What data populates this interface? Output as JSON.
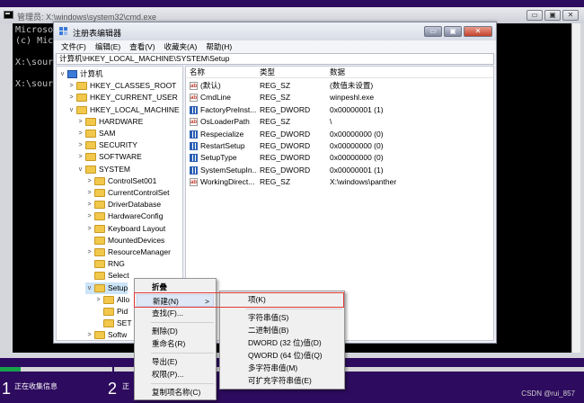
{
  "cmd": {
    "title": "管理员: X:\\windows\\system32\\cmd.exe",
    "lines": [
      "Microsof",
      "(c) Micr",
      "",
      "X:\\sourc",
      "",
      "X:\\sourc"
    ],
    "buttons": [
      "▭",
      "▣",
      "✕"
    ]
  },
  "setup": {
    "progress_fraction": 0.035,
    "step1_number": "1",
    "step1_label": "正在收集信息",
    "step2_number": "2",
    "step2_label": "正",
    "watermark": "CSDN @rui_857"
  },
  "regedit": {
    "title": "注册表编辑器",
    "buttons": [
      "▭",
      "▣",
      "✕"
    ],
    "menus": [
      "文件(F)",
      "编辑(E)",
      "查看(V)",
      "收藏夹(A)",
      "帮助(H)"
    ],
    "address": "计算机\\HKEY_LOCAL_MACHINE\\SYSTEM\\Setup",
    "tree": [
      {
        "label": "计算机",
        "expander": "v",
        "icon": "computer"
      },
      {
        "label": "HKEY_CLASSES_ROOT",
        "expander": ">",
        "icon": "folder"
      },
      {
        "label": "HKEY_CURRENT_USER",
        "expander": ">",
        "icon": "folder"
      },
      {
        "label": "HKEY_LOCAL_MACHINE",
        "expander": "v",
        "icon": "folder"
      },
      {
        "label": "HARDWARE",
        "expander": ">",
        "icon": "folder"
      },
      {
        "label": "SAM",
        "expander": ">",
        "icon": "folder"
      },
      {
        "label": "SECURITY",
        "expander": ">",
        "icon": "folder"
      },
      {
        "label": "SOFTWARE",
        "expander": ">",
        "icon": "folder"
      },
      {
        "label": "SYSTEM",
        "expander": "v",
        "icon": "folder"
      },
      {
        "label": "ControlSet001",
        "expander": ">",
        "icon": "folder"
      },
      {
        "label": "CurrentControlSet",
        "expander": ">",
        "icon": "folder"
      },
      {
        "label": "DriverDatabase",
        "expander": ">",
        "icon": "folder"
      },
      {
        "label": "HardwareConfig",
        "expander": ">",
        "icon": "folder"
      },
      {
        "label": "Keyboard Layout",
        "expander": ">",
        "icon": "folder"
      },
      {
        "label": "MountedDevices",
        "expander": "",
        "icon": "folder"
      },
      {
        "label": "ResourceManager",
        "expander": ">",
        "icon": "folder"
      },
      {
        "label": "RNG",
        "expander": "",
        "icon": "folder"
      },
      {
        "label": "Select",
        "expander": "",
        "icon": "folder"
      },
      {
        "label": "Setup",
        "expander": "v",
        "icon": "folder"
      },
      {
        "label": "Allo",
        "expander": ">",
        "icon": "folder"
      },
      {
        "label": "Pid",
        "expander": "",
        "icon": "folder"
      },
      {
        "label": "SET",
        "expander": "",
        "icon": "folder"
      },
      {
        "label": "Softw",
        "expander": ">",
        "icon": "folder"
      }
    ],
    "columns": {
      "name": "名称",
      "type": "类型",
      "data": "数据"
    },
    "values": [
      {
        "name": "(默认)",
        "type": "REG_SZ",
        "data": "(数值未设置)",
        "icon": "sz"
      },
      {
        "name": "CmdLine",
        "type": "REG_SZ",
        "data": "winpeshl.exe",
        "icon": "sz"
      },
      {
        "name": "FactoryPreInst...",
        "type": "REG_DWORD",
        "data": "0x00000001 (1)",
        "icon": "dword"
      },
      {
        "name": "OsLoaderPath",
        "type": "REG_SZ",
        "data": "\\",
        "icon": "sz"
      },
      {
        "name": "Respecialize",
        "type": "REG_DWORD",
        "data": "0x00000000 (0)",
        "icon": "dword"
      },
      {
        "name": "RestartSetup",
        "type": "REG_DWORD",
        "data": "0x00000000 (0)",
        "icon": "dword"
      },
      {
        "name": "SetupType",
        "type": "REG_DWORD",
        "data": "0x00000000 (0)",
        "icon": "dword"
      },
      {
        "name": "SystemSetupIn...",
        "type": "REG_DWORD",
        "data": "0x00000001 (1)",
        "icon": "dword"
      },
      {
        "name": "WorkingDirect...",
        "type": "REG_SZ",
        "data": "X:\\windows\\panther",
        "icon": "sz"
      }
    ]
  },
  "context_menu": {
    "collapse": "折叠",
    "new": "新建(N)",
    "new_arrow": ">",
    "find": "查找(F)...",
    "delete": "删除(D)",
    "rename": "重命名(R)",
    "export": "导出(E)",
    "permissions": "权限(P)...",
    "copy_key_name": "复制项名称(C)"
  },
  "submenu": {
    "key": "项(K)",
    "string_value": "字符串值(S)",
    "binary_value": "二进制值(B)",
    "dword_value": "DWORD (32 位)值(D)",
    "qword_value": "QWORD (64 位)值(Q)",
    "multi_string_value": "多字符串值(M)",
    "expandable_string_value": "可扩充字符串值(E)"
  },
  "colors": {
    "highlight_border": "#e53935",
    "background": "#2d0b5e",
    "progress": "#16a34a"
  }
}
